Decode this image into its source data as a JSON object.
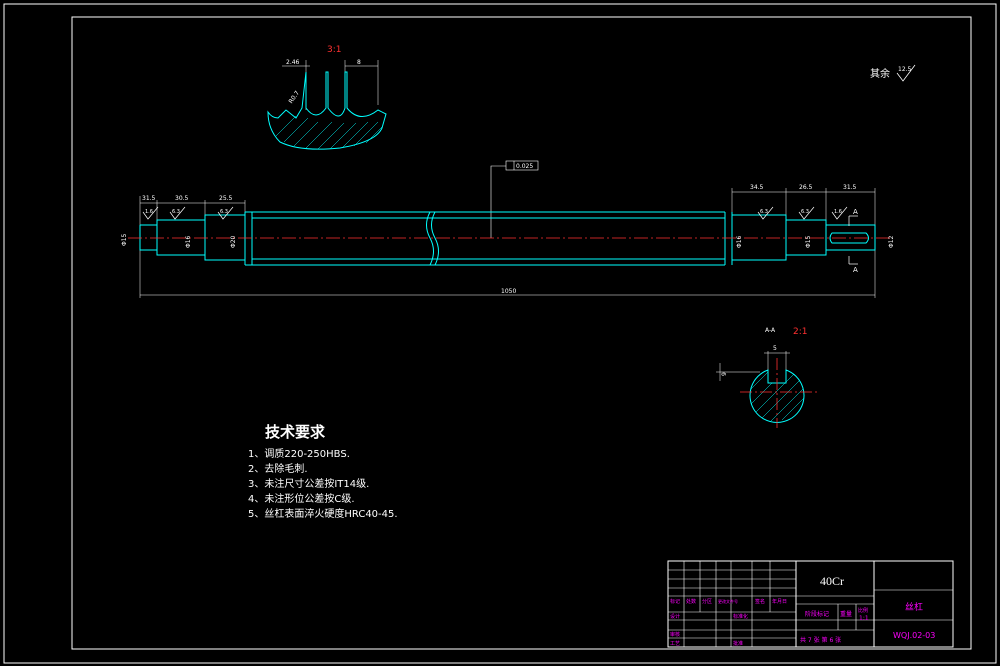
{
  "detail": {
    "scale": "3:1",
    "dim_pitch_left": "2.46",
    "dim_pitch": "8",
    "dim_radius": "R0.7"
  },
  "surface_note": {
    "label": "其余",
    "value": "12.5"
  },
  "shaft": {
    "tolerance": "0.025",
    "top_dims": [
      "31.5",
      "30.5",
      "25.5",
      "34.5",
      "26.5",
      "31.5"
    ],
    "diameters": [
      "Φ15",
      "Φ16",
      "Φ20",
      "Φ16",
      "Φ15",
      "Φ12"
    ],
    "roughness": [
      "1.6",
      "6.3",
      "6.3",
      "6.3",
      "6.3",
      "1.6"
    ],
    "total_length": "1050",
    "section_letter": "A"
  },
  "section": {
    "label": "A-A",
    "scale": "2:1",
    "key_width": "5",
    "key_depth": "9"
  },
  "tech_requirements": {
    "title": "技术要求",
    "items": [
      "1、调质220-250HBS.",
      "2、去除毛刺.",
      "3、未注尺寸公差按IT14级.",
      "4、未注形位公差按C级.",
      "5、丝杠表面淬火硬度HRC40-45."
    ]
  },
  "title_block": {
    "material": "40Cr",
    "part_name": "丝杠",
    "drawing_no": "WQJ.02-03",
    "sheet_info": "共 7 张 第 6 张",
    "scale_label": "比例",
    "scale_value": "1:1",
    "weight_label": "重量",
    "stage_label": "阶段标记",
    "row_labels": [
      "标记",
      "处数",
      "分区",
      "更改文件号",
      "签名",
      "年月日"
    ],
    "role_labels": [
      "设计",
      "标准化",
      "审核",
      "工艺",
      "批准"
    ]
  }
}
